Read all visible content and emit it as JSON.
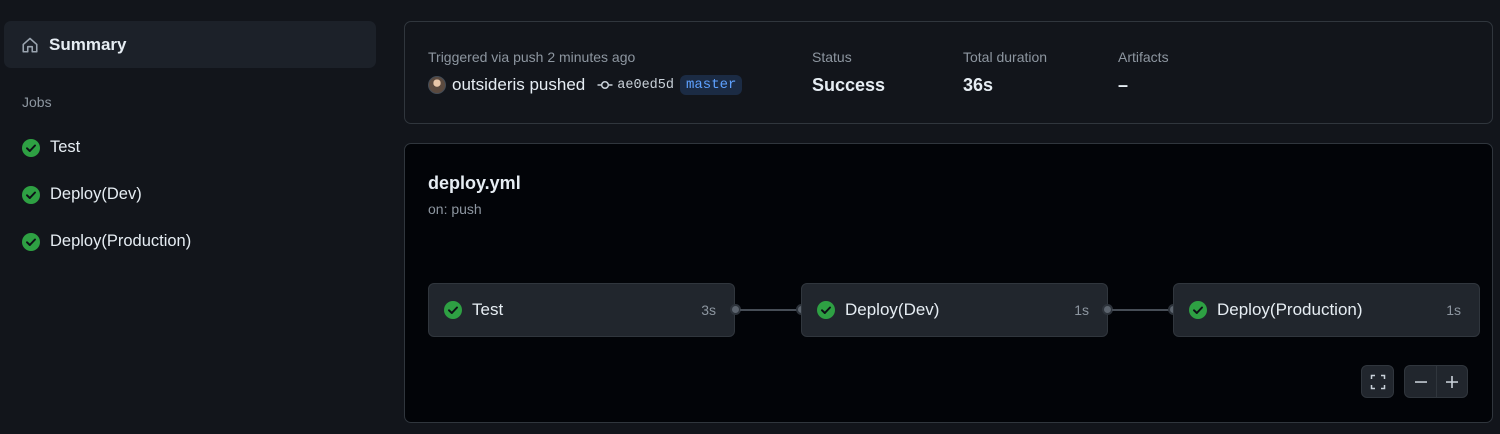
{
  "sidebar": {
    "summary_label": "Summary",
    "jobs_heading": "Jobs",
    "jobs": [
      {
        "label": "Test",
        "status": "success"
      },
      {
        "label": "Deploy(Dev)",
        "status": "success"
      },
      {
        "label": "Deploy(Production)",
        "status": "success"
      }
    ]
  },
  "run": {
    "trigger_text": "Triggered via push 2 minutes ago",
    "actor_text": "outsideris pushed",
    "commit_sha": "ae0ed5d",
    "branch": "master",
    "status_label": "Status",
    "status_value": "Success",
    "duration_label": "Total duration",
    "duration_value": "36s",
    "artifacts_label": "Artifacts",
    "artifacts_value": "–"
  },
  "workflow": {
    "name": "deploy.yml",
    "trigger": "on: push",
    "jobs": [
      {
        "label": "Test",
        "duration": "3s"
      },
      {
        "label": "Deploy(Dev)",
        "duration": "1s"
      },
      {
        "label": "Deploy(Production)",
        "duration": "1s"
      }
    ]
  },
  "colors": {
    "success": "#2ea043",
    "accent_branch": "#5ea1ff",
    "background": "#12151b",
    "graph_background": "#020408"
  },
  "icons": {
    "summary": "home-icon",
    "job_status": "check-circle-icon",
    "commit": "git-commit-icon",
    "fullscreen": "fullscreen-icon",
    "zoom_out": "minus-icon",
    "zoom_in": "plus-icon"
  }
}
